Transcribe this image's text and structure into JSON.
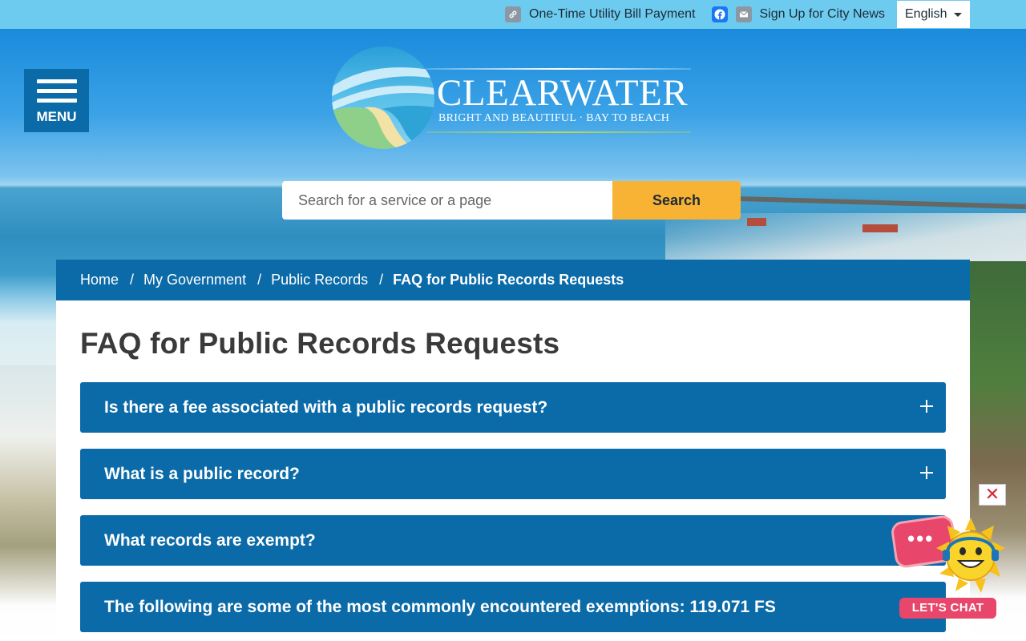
{
  "utility_bar": {
    "bill_payment_label": "One-Time Utility Bill Payment",
    "news_signup_label": "Sign Up for City News",
    "language_selected": "English",
    "icons": [
      "link-icon",
      "facebook-icon",
      "mail-icon"
    ]
  },
  "menu": {
    "label": "MENU"
  },
  "logo": {
    "wordmark": "CLEARWATER",
    "tagline": "BRIGHT AND BEAUTIFUL · BAY TO BEACH"
  },
  "search": {
    "placeholder": "Search for a service or a page",
    "button_label": "Search"
  },
  "breadcrumb": {
    "items": [
      "Home",
      "My Government",
      "Public Records"
    ],
    "current": "FAQ for Public Records Requests",
    "separator": "/"
  },
  "main": {
    "title": "FAQ for Public Records Requests",
    "faqs": [
      {
        "question": "Is there a fee associated with a public records request?"
      },
      {
        "question": "What is a public record?"
      },
      {
        "question": "What records are exempt?"
      },
      {
        "question": "The following are some of the most commonly encountered exemptions: 119.071 FS"
      }
    ]
  },
  "chat": {
    "close_label": "✕",
    "label": "LET'S CHAT",
    "dots": "•••"
  },
  "colors": {
    "topbar": "#6ecbf0",
    "primary_blue": "#0b6aa8",
    "search_button": "#f8b334",
    "chat_pink": "#e8466b",
    "title_text": "#3a3a3a"
  }
}
